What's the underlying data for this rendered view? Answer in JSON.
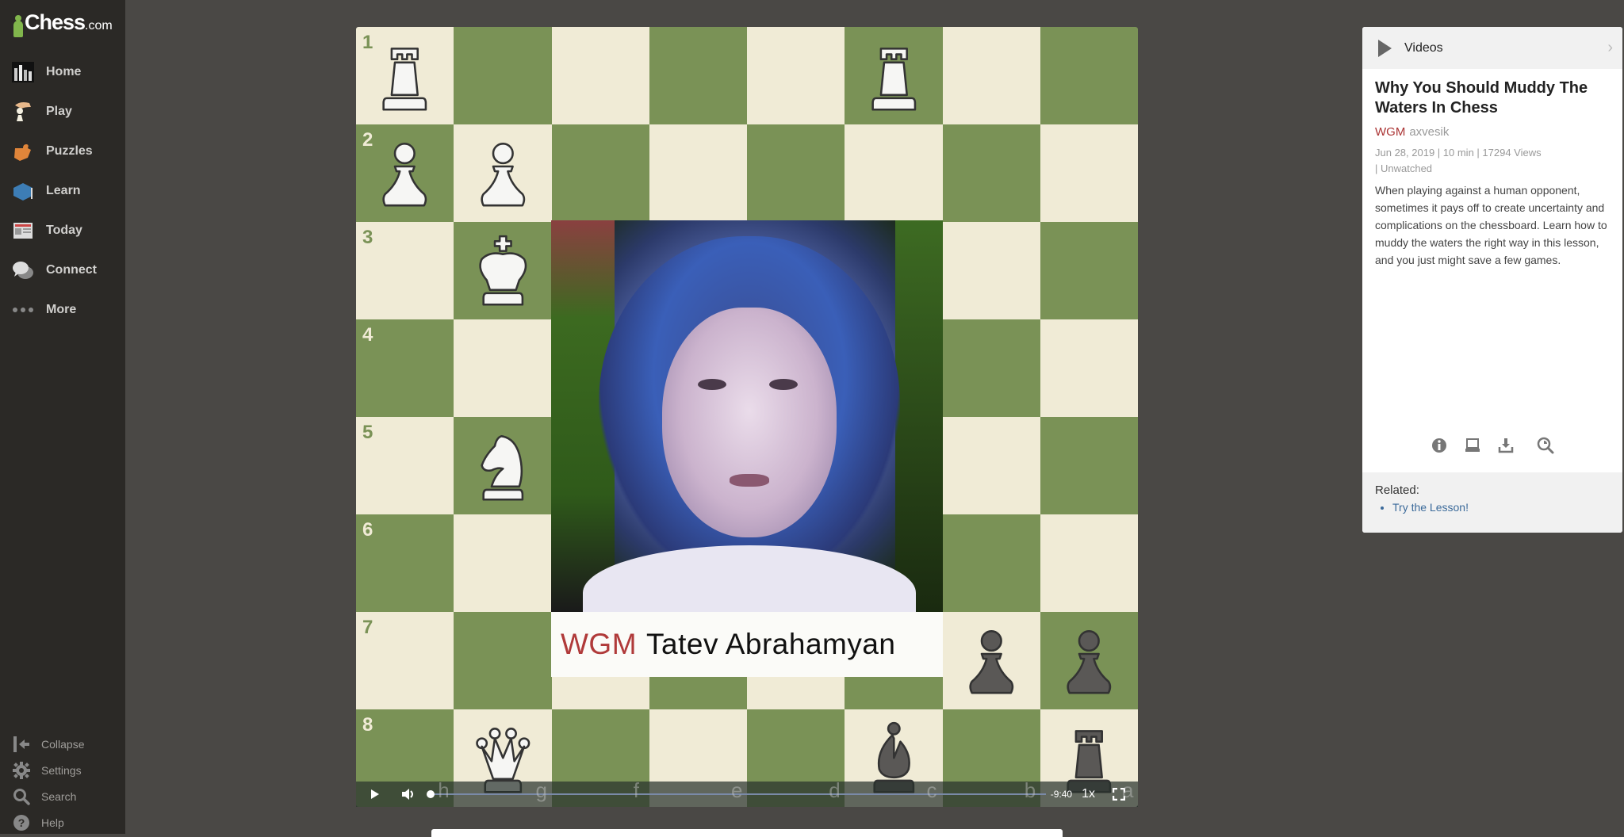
{
  "sidebar": {
    "logo": {
      "brand": "Chess",
      "suffix": ".com"
    },
    "items": [
      {
        "label": "Home",
        "icon": "home-icon"
      },
      {
        "label": "Play",
        "icon": "play-hand-icon"
      },
      {
        "label": "Puzzles",
        "icon": "puzzle-icon"
      },
      {
        "label": "Learn",
        "icon": "graduation-cap-icon"
      },
      {
        "label": "Today",
        "icon": "newspaper-icon"
      },
      {
        "label": "Connect",
        "icon": "chat-bubbles-icon"
      },
      {
        "label": "More",
        "icon": "more-dots-icon"
      }
    ],
    "bottom_items": [
      {
        "label": "Collapse",
        "icon": "collapse-icon"
      },
      {
        "label": "Settings",
        "icon": "gear-icon"
      },
      {
        "label": "Search",
        "icon": "search-icon"
      },
      {
        "label": "Help",
        "icon": "help-icon"
      }
    ]
  },
  "board": {
    "colors": {
      "light": "#f0ebd6",
      "dark": "#7a9256"
    },
    "ranks": [
      "1",
      "2",
      "3",
      "4",
      "5",
      "6",
      "7",
      "8"
    ],
    "files": [
      "h",
      "g",
      "f",
      "e",
      "d",
      "c",
      "b",
      "a"
    ],
    "pieces": [
      {
        "square": "h1",
        "piece": "rook",
        "color": "white"
      },
      {
        "square": "c1",
        "piece": "rook",
        "color": "white"
      },
      {
        "square": "h2",
        "piece": "pawn",
        "color": "white"
      },
      {
        "square": "g2",
        "piece": "pawn",
        "color": "white"
      },
      {
        "square": "g3",
        "piece": "king",
        "color": "white"
      },
      {
        "square": "g5",
        "piece": "knight",
        "color": "white"
      },
      {
        "square": "b7",
        "piece": "pawn",
        "color": "black"
      },
      {
        "square": "a7",
        "piece": "pawn",
        "color": "black"
      },
      {
        "square": "g8",
        "piece": "queen",
        "color": "white"
      },
      {
        "square": "c8",
        "piece": "bishop",
        "color": "black"
      },
      {
        "square": "a8",
        "piece": "rook",
        "color": "black"
      }
    ]
  },
  "video": {
    "lower_third": {
      "title": "WGM",
      "name": "Tatev Abrahamyan"
    },
    "controls": {
      "time_remaining": "-9:40",
      "speed": "1x",
      "progress": 0
    }
  },
  "panel": {
    "header": "Videos",
    "title": "Why You Should Muddy The Waters In Chess",
    "author_title": "WGM",
    "author": "axvesik",
    "meta_line1": "Jun 28, 2019 |  10 min |  17294 Views",
    "meta_line2": " |  Unwatched",
    "description": "When playing against a human opponent, sometimes it pays off to create uncertainty and complications on the chessboard. Learn how to muddy the waters the right way in this lesson, and you just might save a few games.",
    "tools": [
      "info-icon",
      "computer-icon",
      "download-icon",
      "analysis-icon"
    ],
    "related_label": "Related:",
    "related_links": [
      "Try the Lesson!"
    ]
  }
}
